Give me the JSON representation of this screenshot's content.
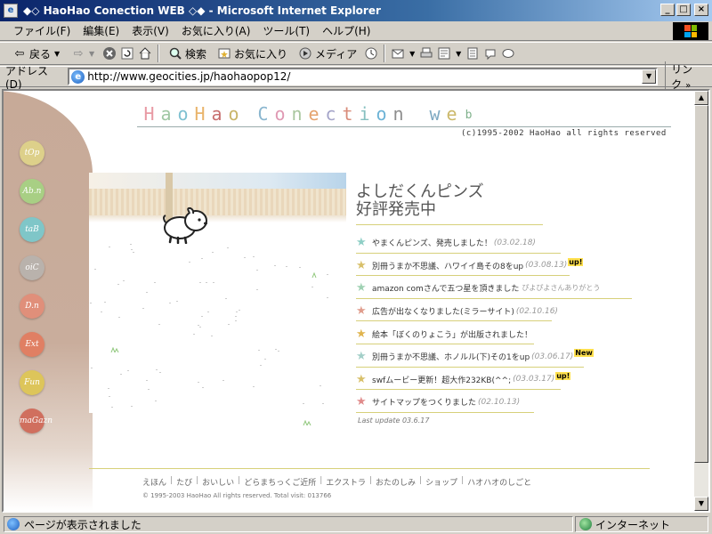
{
  "window": {
    "title": "◆◇ HaoHao Conection WEB ◇◆ - Microsoft Internet Explorer",
    "minimize": "_",
    "maximize": "□",
    "close": "×"
  },
  "menu": {
    "items": [
      "ファイル(F)",
      "編集(E)",
      "表示(V)",
      "お気に入り(A)",
      "ツール(T)",
      "ヘルプ(H)"
    ]
  },
  "toolbar": {
    "back": "戻る",
    "search": "検索",
    "favorites": "お気に入り",
    "media": "メディア"
  },
  "address": {
    "label": "アドレス(D)",
    "url": "http://www.geocities.jp/haohaopop12/",
    "links": "リンク",
    "links_more": "»"
  },
  "page": {
    "logo_letters": [
      "H",
      "a",
      "o",
      "H",
      "a",
      "o",
      "C",
      "o",
      "n",
      "e",
      "c",
      "t",
      "i",
      "o",
      "n",
      "w",
      "e",
      "b"
    ],
    "copyright_top": "(c)1995-2002 HaoHao all rights reserved",
    "side_nav": [
      "tOp",
      "Ab.n",
      "taB",
      "oiC",
      "D.n",
      "Ext",
      "Fun",
      "maGazn"
    ],
    "headline_line1": "よしだくんピンズ",
    "headline_line2": "好評発売中",
    "news": [
      {
        "text": "やまくんピンズ、発売しました！",
        "date": "(03.02.18)",
        "badge": "",
        "thanks": ""
      },
      {
        "text": "別冊うまか不思議、ハワイイ島その8をup",
        "date": "(03.08.13)",
        "badge": "up!",
        "thanks": ""
      },
      {
        "text": "amazon comさんで五つ星を頂きました",
        "date": "",
        "badge": "",
        "thanks": "ぴよぴよさんありがとう"
      },
      {
        "text": "広告が出なくなりました(ミラーサイト)",
        "date": "(02.10.16)",
        "badge": "",
        "thanks": ""
      },
      {
        "text": "絵本「ぼくのりょこう」が出版されました！",
        "date": "",
        "badge": "",
        "thanks": ""
      },
      {
        "text": "別冊うまか不思議、ホノルル(下)その1をup",
        "date": "(03.06.17)",
        "badge": "New",
        "thanks": ""
      },
      {
        "text": "swfムービー更新！超大作232KB(^^;",
        "date": "(03.03.17)",
        "badge": "up!",
        "thanks": ""
      },
      {
        "text": "サイトマップをつくりました",
        "date": "(02.10.13)",
        "badge": "",
        "thanks": ""
      }
    ],
    "last_update": "Last update 03.6.17",
    "footer_nav": [
      "えほん",
      "たび",
      "おいしい",
      "どらまちっくご近所",
      "エクストラ",
      "おたのしみ",
      "ショップ",
      "ハオハオのしごと"
    ],
    "footer_copy": "© 1995-2003 HaoHao All rights reserved. Total visit: 013766"
  },
  "status": {
    "message": "ページが表示されました",
    "zone": "インターネット"
  },
  "colors": {
    "logo": [
      "#e89aa4",
      "#9fc7a3",
      "#7fc1d1",
      "#e9b46b",
      "#c76e6e",
      "#c9b56a",
      "#8ab6cf",
      "#e09ab4",
      "#aac7a0",
      "#e5a36e",
      "#a5a5c9",
      "#d98c7a",
      "#86c0c0",
      "#6db3d6",
      "#8e8e8e",
      "#7ea9c2",
      "#ccb96b",
      "#7fb18b"
    ],
    "side_nav": [
      "#ddd08a",
      "#a8cf84",
      "#7fc6c8",
      "#b9b2ac",
      "#e08f7a",
      "#e07f63",
      "#ddc55a",
      "#d06f5e"
    ],
    "stars": [
      "#8fcfc6",
      "#d8c06a",
      "#9fd1b3",
      "#e09d8d",
      "#e0b44e",
      "#a3cfc8",
      "#d8c06a",
      "#e08b8b"
    ]
  }
}
